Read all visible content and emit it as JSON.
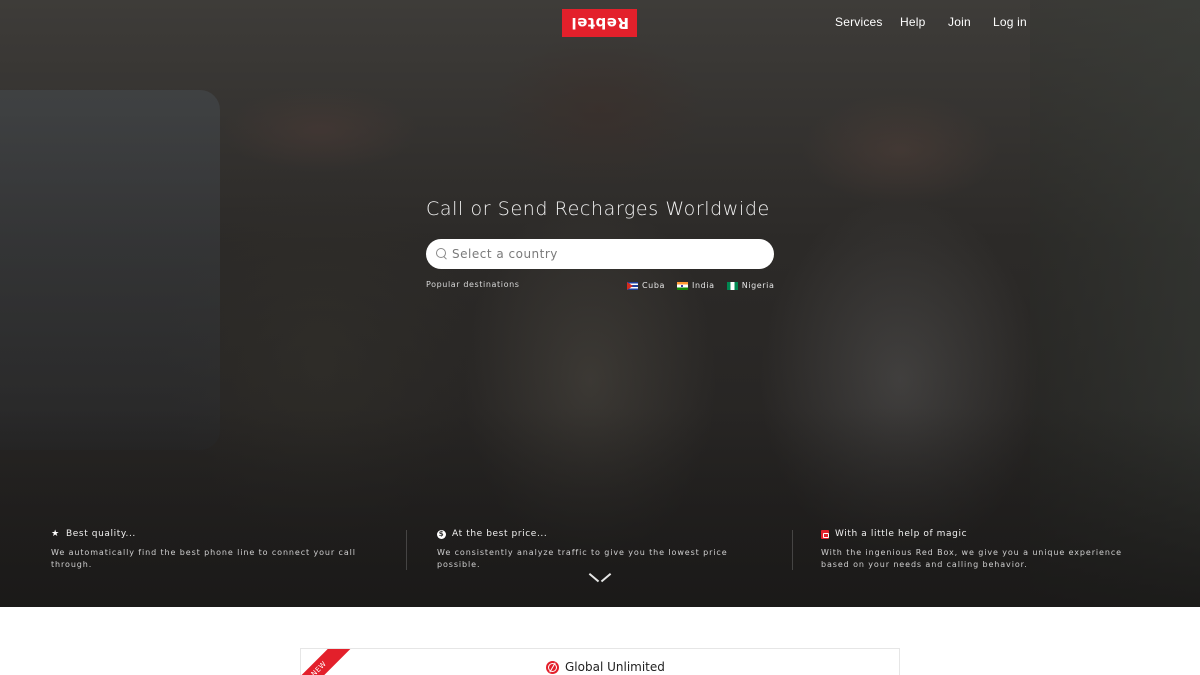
{
  "header": {
    "logo_text": "Rebtel",
    "nav": {
      "services": "Services",
      "help": "Help",
      "join": "Join",
      "login": "Log in"
    }
  },
  "hero": {
    "title": "Call or Send Recharges Worldwide",
    "search": {
      "placeholder": "Select a country",
      "value": ""
    },
    "popular_label": "Popular destinations",
    "destinations": [
      {
        "name": "Cuba",
        "flag": "cuba-flag"
      },
      {
        "name": "India",
        "flag": "india-flag"
      },
      {
        "name": "Nigeria",
        "flag": "nigeria-flag"
      }
    ]
  },
  "features": [
    {
      "icon": "star-icon",
      "title": "Best quality...",
      "description": "We automatically find the best phone line to connect your call through."
    },
    {
      "icon": "dollar-coin-icon",
      "title": "At the best price...",
      "description": "We consistently analyze traffic to give you the lowest price possible."
    },
    {
      "icon": "red-box-icon",
      "title": "With a little help of magic",
      "description": "With the ingenious Red Box, we give you a unique experience based on your needs and calling behavior."
    }
  ],
  "card": {
    "badge": "NEW",
    "title": "Global Unlimited"
  },
  "colors": {
    "brand_red": "#e3202b",
    "hero_overlay": "#2c2a28"
  }
}
